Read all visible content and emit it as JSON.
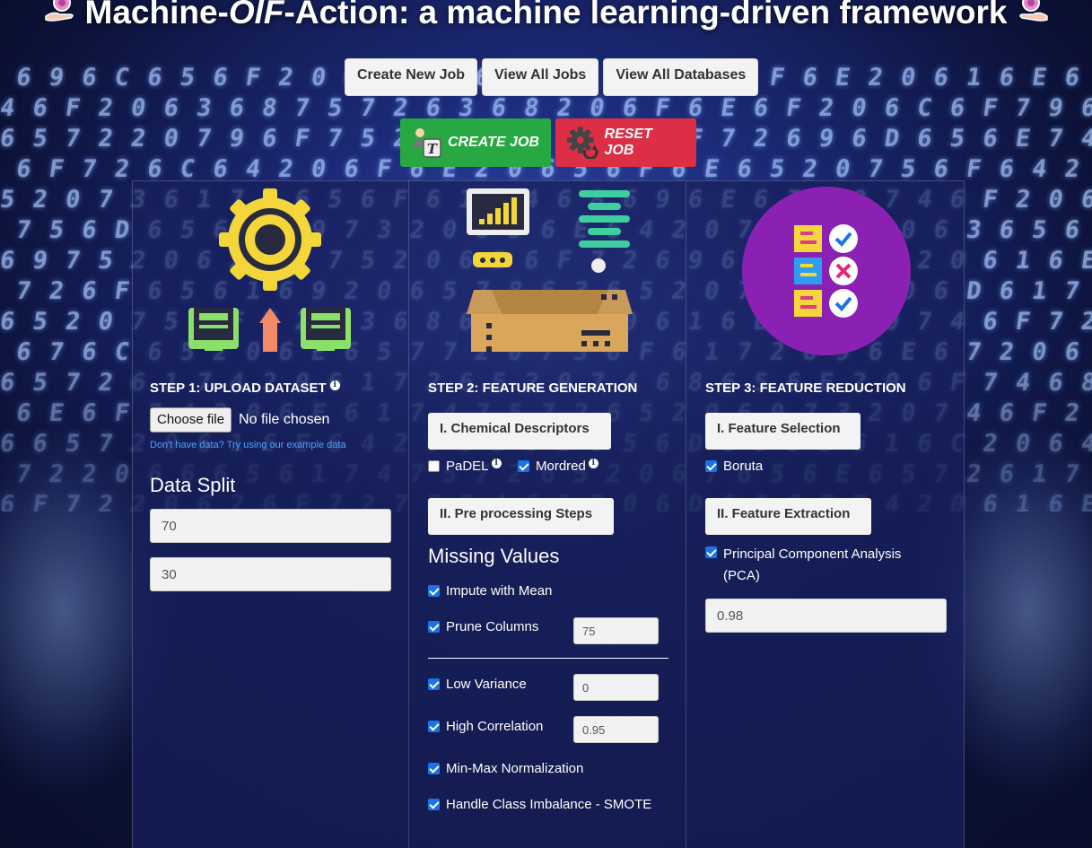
{
  "header": {
    "title_prefix": "Machine-",
    "title_italic": "OlF",
    "title_suffix": "-Action: a machine learning-driven framework"
  },
  "nav": {
    "create_new_job": "Create New Job",
    "view_all_jobs": "View All Jobs",
    "view_all_databases": "View All Databases"
  },
  "actions": {
    "create_job": "CREATE JOB",
    "reset_job": "RESET JOB"
  },
  "step1": {
    "title": "STEP 1: UPLOAD DATASET",
    "file_button": "Choose file",
    "file_status": "No file chosen",
    "hint": "Don't have data? Try using our example data",
    "data_split_label": "Data Split",
    "train_split": "70",
    "test_split": "30"
  },
  "step2": {
    "title": "STEP 2: FEATURE GENERATION",
    "chem_descriptors_label": "I. Chemical Descriptors",
    "padel_label": "PaDEL",
    "padel_checked": false,
    "mordred_label": "Mordred",
    "mordred_checked": true,
    "preprocessing_label": "II. Pre processing Steps",
    "missing_values_label": "Missing Values",
    "impute_mean_label": "Impute with Mean",
    "prune_columns_label": "Prune Columns",
    "prune_columns_value": "75",
    "low_variance_label": "Low Variance",
    "low_variance_value": "0",
    "high_correlation_label": "High Correlation",
    "high_correlation_value": "0.95",
    "minmax_label": "Min-Max Normalization",
    "smote_label": "Handle Class Imbalance - SMOTE"
  },
  "step3": {
    "title": "STEP 3: FEATURE REDUCTION",
    "feature_selection_label": "I. Feature Selection",
    "boruta_label": "Boruta",
    "feature_extraction_label": "II. Feature Extraction",
    "pca_label_line1": "Principal Component Analysis",
    "pca_label_line2": "(PCA)",
    "pca_value": "0.98"
  },
  "colors": {
    "create_green": "#27a843",
    "reset_red": "#dc2f45",
    "hint_blue": "#4ea3ff",
    "checkbox_blue": "#1a73e8"
  }
}
